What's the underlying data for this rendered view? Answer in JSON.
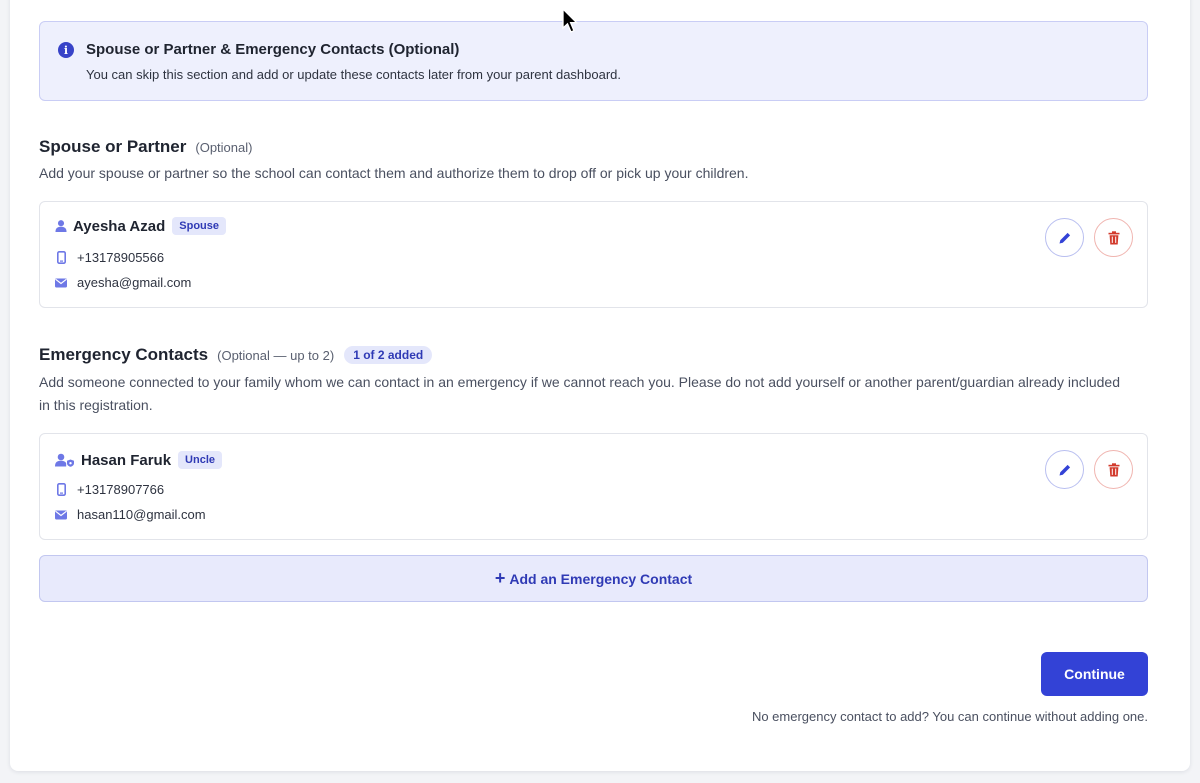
{
  "banner": {
    "title": "Spouse or Partner & Emergency Contacts (Optional)",
    "text": "You can skip this section and add or update these contacts later from your parent dashboard.",
    "icon": "info-icon",
    "icon_glyph": "i"
  },
  "spouse_section": {
    "title": "Spouse or Partner",
    "optional_label": "(Optional)",
    "description": "Add your spouse or partner so the school can contact them and authorize them to drop off or pick up your children.",
    "contact": {
      "name": "Ayesha Azad",
      "relation": "Spouse",
      "phone": "+13178905566",
      "email": "ayesha@gmail.com"
    }
  },
  "emergency_section": {
    "title": "Emergency Contacts",
    "optional_label": "(Optional — up to 2)",
    "count_badge": "1 of 2 added",
    "description": "Add someone connected to your family whom we can contact in an emergency if we cannot reach you. Please do not add yourself or another parent/guardian already included in this registration.",
    "contact": {
      "name": "Hasan Faruk",
      "relation": "Uncle",
      "phone": "+13178907766",
      "email": "hasan110@gmail.com"
    },
    "add_label": "Add an Emergency Contact",
    "add_glyph": "+"
  },
  "footer": {
    "continue_label": "Continue",
    "note": "No emergency contact to add? You can continue without adding one."
  },
  "colors": {
    "primary": "#3342d6",
    "accent_text": "#2f3ab5",
    "danger": "#d23a2c",
    "banner_bg": "#eef0fd"
  }
}
